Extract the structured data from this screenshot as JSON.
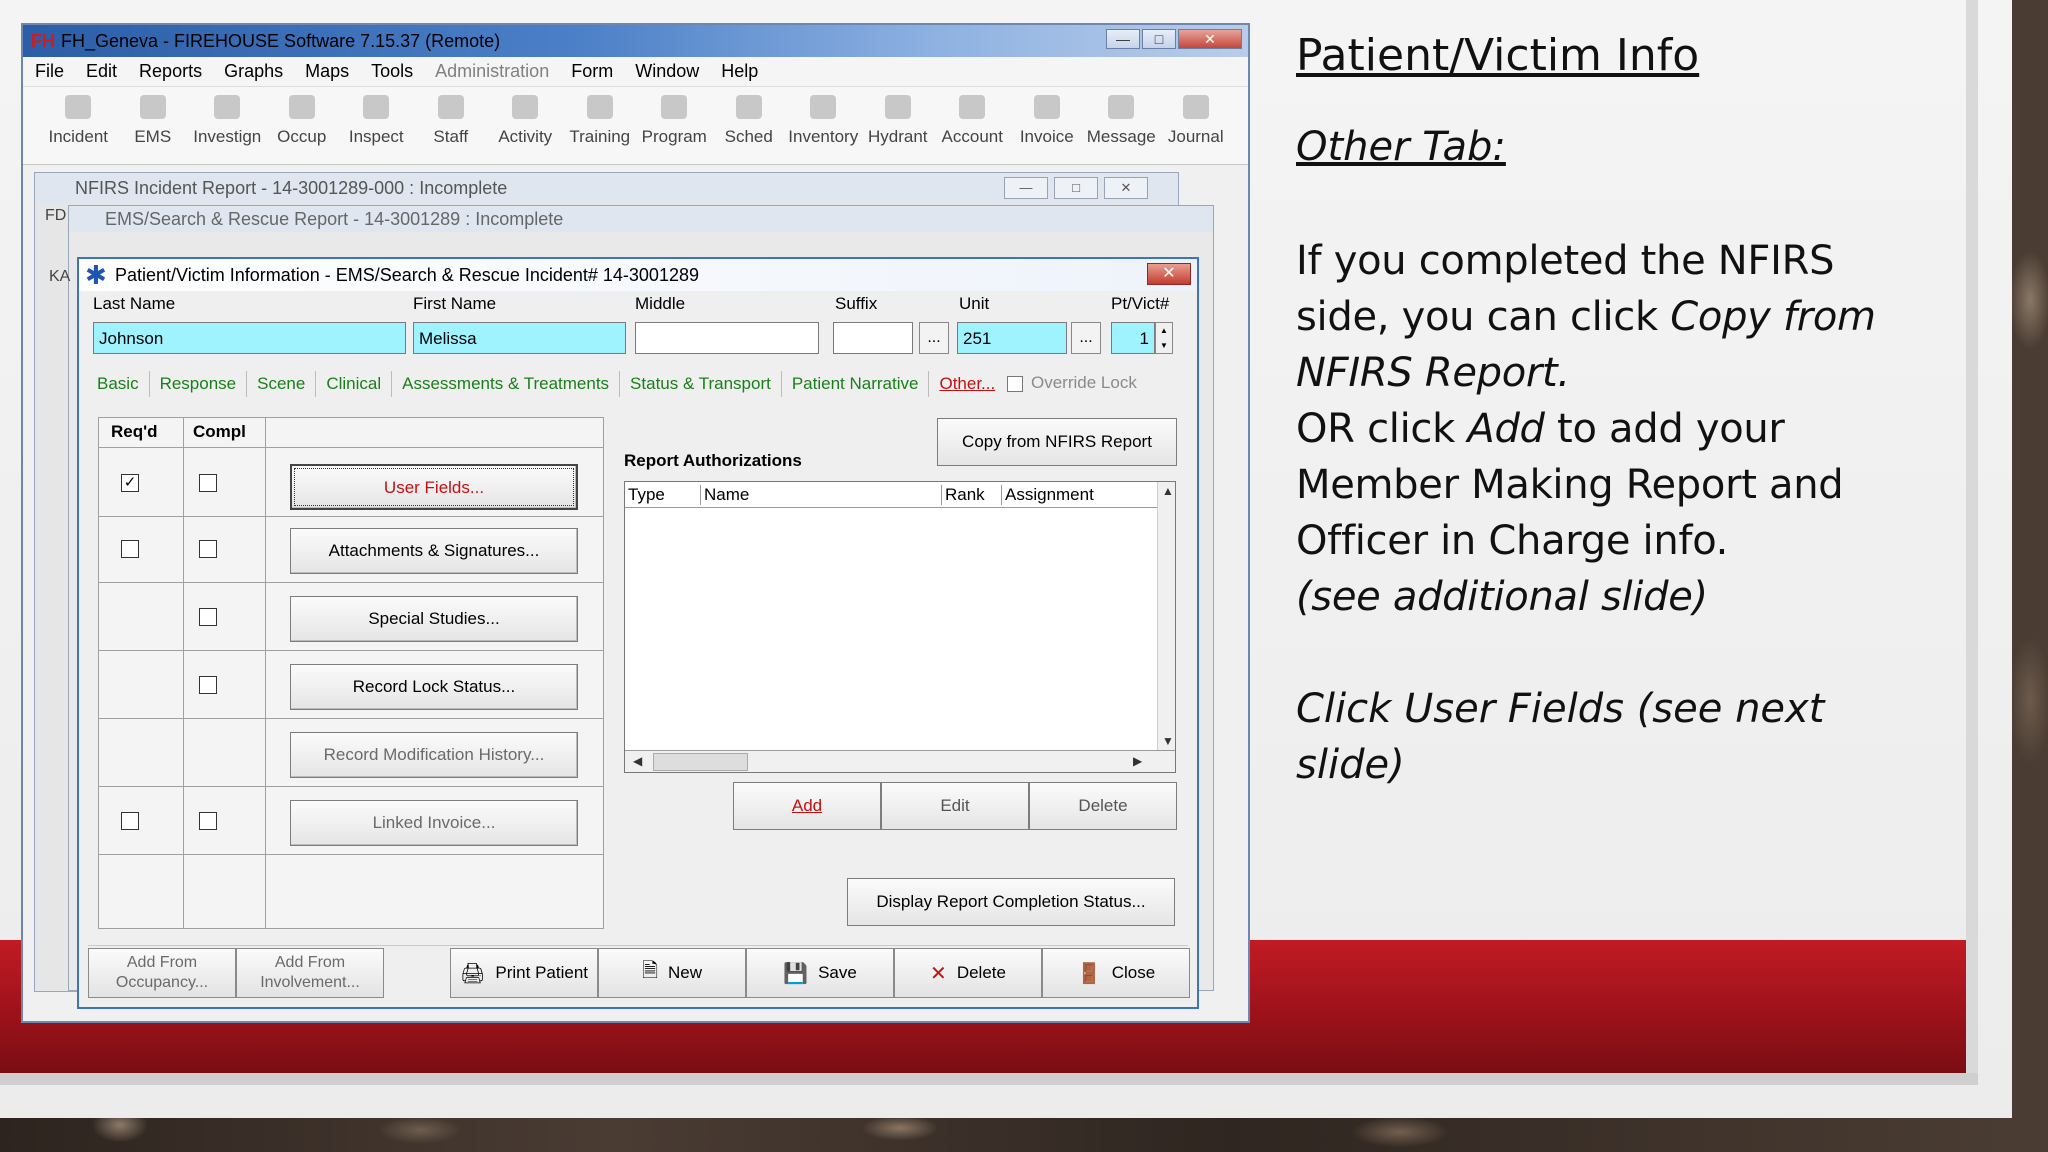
{
  "slide": {
    "title": "Patient/Victim Info",
    "subtitle": "Other Tab:",
    "line1": "If you completed the NFIRS",
    "line2a": "side, you can click ",
    "line2b": "Copy from",
    "line3": "NFIRS Report.",
    "line4a": "OR click ",
    "line4b": "Add",
    "line4c": " to add your",
    "line5": "Member Making Report and",
    "line6": "Officer in Charge info.",
    "line7": "(see additional slide)",
    "footer": "Click User Fields (see next slide)"
  },
  "app": {
    "logo": "FH",
    "title": "FH_Geneva - FIREHOUSE Software 7.15.37 (Remote)",
    "menu": [
      "File",
      "Edit",
      "Reports",
      "Graphs",
      "Maps",
      "Tools",
      "Administration",
      "Form",
      "Window",
      "Help"
    ],
    "toolbar": [
      "Incident",
      "EMS",
      "Investign",
      "Occup",
      "Inspect",
      "Staff",
      "Activity",
      "Training",
      "Program",
      "Sched",
      "Inventory",
      "Hydrant",
      "Account",
      "Invoice",
      "Message",
      "Journal"
    ]
  },
  "nfirs": {
    "title": "NFIRS Incident Report  - 14-3001289-000   : Incomplete",
    "side_label": "FD"
  },
  "ems": {
    "title": "EMS/Search & Rescue Report  - 14-3001289   : Incomplete",
    "side_label": "KA"
  },
  "dialog": {
    "title": "Patient/Victim Information - EMS/Search & Rescue Incident# 14-3001289",
    "labels": {
      "last": "Last Name",
      "first": "First Name",
      "middle": "Middle",
      "suffix": "Suffix",
      "unit": "Unit",
      "ptvict": "Pt/Vict#"
    },
    "values": {
      "last": "Johnson",
      "first": "Melissa",
      "middle": "",
      "suffix": "",
      "unit": "251",
      "ptvict": "1"
    },
    "dots": "...",
    "tabs": [
      "Basic",
      "Response",
      "Scene",
      "Clinical",
      "Assessments & Treatments",
      "Status & Transport",
      "Patient Narrative",
      "Other..."
    ],
    "override": "Override Lock",
    "grid_headers": {
      "reqd": "Req'd",
      "compl": "Compl"
    },
    "grid_buttons": [
      "User Fields...",
      "Attachments & Signatures...",
      "Special Studies...",
      "Record Lock Status...",
      "Record Modification History...",
      "Linked Invoice..."
    ],
    "copy_button": "Copy from NFIRS Report",
    "ra_label": "Report Authorizations",
    "ra_columns": [
      "Type",
      "Name",
      "Rank",
      "Assignment"
    ],
    "ra_buttons": [
      "Add",
      "Edit",
      "Delete"
    ],
    "status_button": "Display Report Completion Status...",
    "bottom": {
      "add_occ1": "Add From",
      "add_occ2": "Occupancy...",
      "add_inv1": "Add From",
      "add_inv2": "Involvement...",
      "print": "Print Patient",
      "new": "New",
      "save": "Save",
      "delete": "Delete",
      "close": "Close"
    }
  }
}
